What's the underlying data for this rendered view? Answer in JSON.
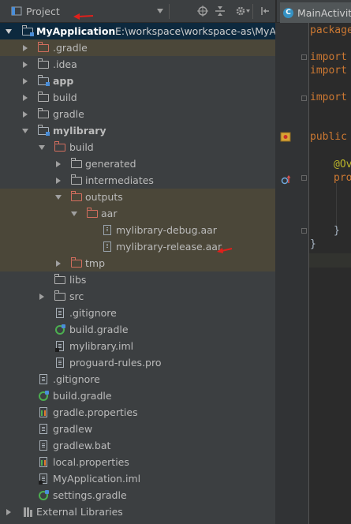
{
  "project_panel": {
    "view_label": "Project",
    "root": {
      "name": "MyApplication",
      "path": "E:\\workspace\\workspace-as\\MyAp"
    },
    "items": [
      {
        "label": ".gradle"
      },
      {
        "label": ".idea"
      },
      {
        "label": "app"
      },
      {
        "label": "build"
      },
      {
        "label": "gradle"
      },
      {
        "label": "mylibrary"
      },
      {
        "label": "build"
      },
      {
        "label": "generated"
      },
      {
        "label": "intermediates"
      },
      {
        "label": "outputs"
      },
      {
        "label": "aar"
      },
      {
        "label": "mylibrary-debug.aar"
      },
      {
        "label": "mylibrary-release.aar"
      },
      {
        "label": "tmp"
      },
      {
        "label": "libs"
      },
      {
        "label": "src"
      },
      {
        "label": ".gitignore"
      },
      {
        "label": "build.gradle"
      },
      {
        "label": "mylibrary.iml"
      },
      {
        "label": "proguard-rules.pro"
      },
      {
        "label": ".gitignore"
      },
      {
        "label": "build.gradle"
      },
      {
        "label": "gradle.properties"
      },
      {
        "label": "gradlew"
      },
      {
        "label": "gradlew.bat"
      },
      {
        "label": "local.properties"
      },
      {
        "label": "MyApplication.iml"
      },
      {
        "label": "settings.gradle"
      },
      {
        "label": "External Libraries"
      }
    ]
  },
  "editor": {
    "tab_label": "MainActivity",
    "code_lines": [
      "package",
      "import",
      "import",
      "import",
      "public",
      "@Ov",
      "pro",
      "}",
      "}"
    ]
  },
  "colors": {
    "annotation_arrow": "#e0201b",
    "highlight_row": "#4b4739",
    "selected_row": "#0d293e"
  }
}
